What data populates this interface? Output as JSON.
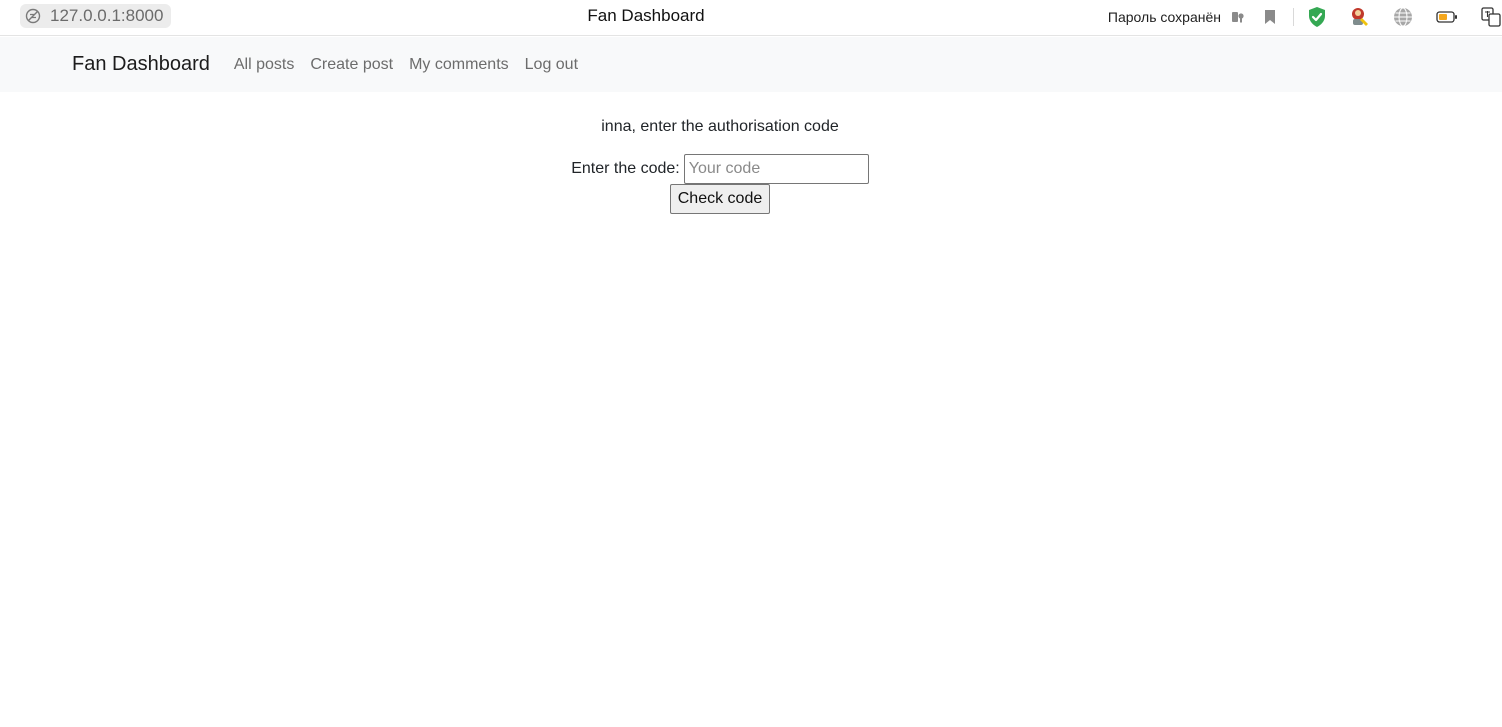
{
  "browser": {
    "url": "127.0.0.1:8000",
    "window_title": "Fan Dashboard",
    "password_saved_text": "Пароль сохранён",
    "icons": [
      "site-settings-icon",
      "password-key-icon",
      "bookmark-icon",
      "shield-check-icon",
      "extension-icon",
      "globe-icon",
      "battery-icon",
      "translate-icon"
    ]
  },
  "navbar": {
    "brand": "Fan Dashboard",
    "links": [
      "All posts",
      "Create post",
      "My comments",
      "Log out"
    ]
  },
  "main": {
    "prompt": "inna, enter the authorisation code",
    "code_label": "Enter the code:",
    "code_placeholder": "Your code",
    "code_value": "",
    "submit_label": "Check code"
  },
  "colors": {
    "navbar_bg": "#f8f9fa",
    "shield_green": "#34a853",
    "battery_orange": "#f4a61c"
  }
}
